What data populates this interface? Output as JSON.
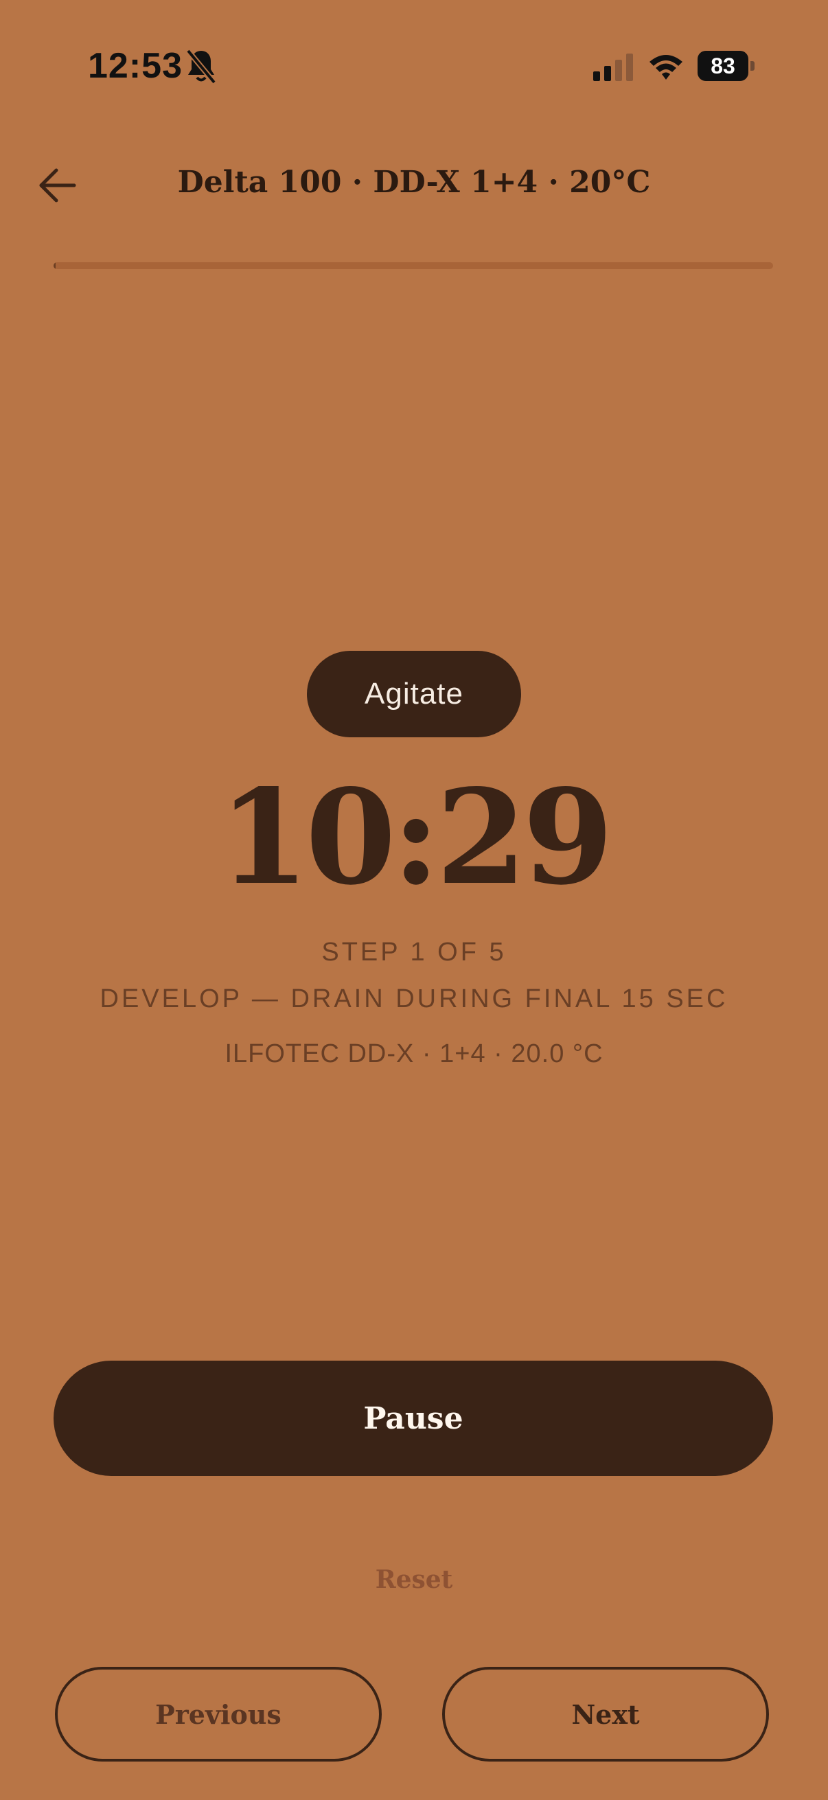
{
  "status_bar": {
    "time": "12:53",
    "battery": "83",
    "icons": [
      "bell-slash-icon",
      "cellular-signal-icon",
      "wifi-icon",
      "battery-icon"
    ]
  },
  "header": {
    "back_icon": "arrow-left-icon",
    "title": "Delta 100 · DD-X 1+4 · 20°C",
    "progress": 0.003
  },
  "timer": {
    "prompt": "Agitate",
    "remaining": "10:29",
    "step_label": "STEP 1 OF 5",
    "step_name": "DEVELOP — DRAIN DURING FINAL 15 SEC",
    "chemistry": "ILFOTEC DD-X · 1+4 · 20.0 °C"
  },
  "controls": {
    "pause_label": "Pause",
    "reset_label": "Reset",
    "previous_label": "Previous",
    "next_label": "Next"
  },
  "colors": {
    "background": "#B87546",
    "primary_dark": "#3A2316",
    "muted_text": "#6A3F25"
  }
}
